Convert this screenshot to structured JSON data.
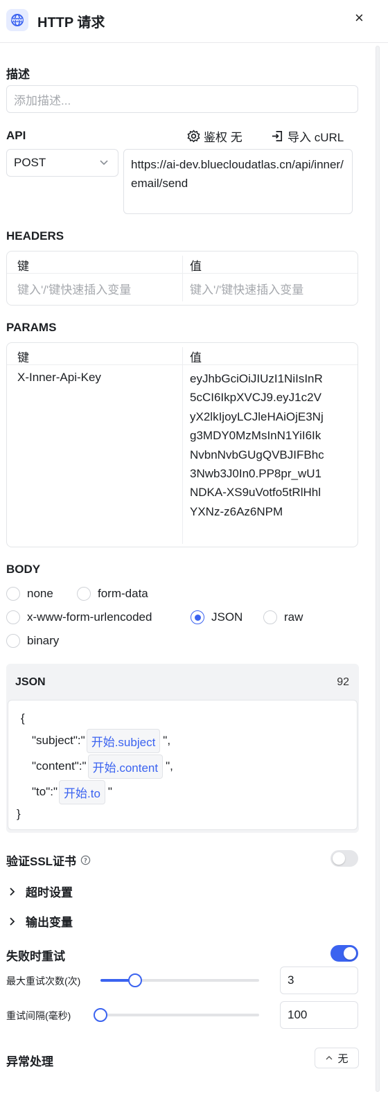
{
  "header": {
    "title": "HTTP 请求",
    "close_label": "×"
  },
  "description": {
    "label": "描述",
    "placeholder": "添加描述..."
  },
  "api": {
    "label": "API",
    "auth_label": "鉴权 无",
    "import_label": "导入 cURL",
    "method": "POST",
    "url": "https://ai-dev.bluecloudatlas.cn/api/inner/email/send"
  },
  "headers": {
    "label": "HEADERS",
    "col_key": "键",
    "col_value": "值",
    "key_placeholder": "键入'/'键快速插入变量",
    "value_placeholder": "键入'/'键快速插入变量"
  },
  "params": {
    "label": "PARAMS",
    "col_key": "键",
    "col_value": "值",
    "rows": [
      {
        "key": "X-Inner-Api-Key",
        "value": "eyJhbGciOiJIUzI1NiIsInR5cCI6IkpXVCJ9.eyJ1c2VyX2lkIjoyLCJleHAiOjE3Njg3MDY0MzMsInN1YiI6IkNvbnNvbGUgQVBJIFBhc3Nwb3J0In0.PP8pr_wU1NDKA-XS9uVotfo5tRlHhlYXNz-z6Az6NPM"
      }
    ]
  },
  "body": {
    "label": "BODY",
    "options": [
      "none",
      "form-data",
      "x-www-form-urlencoded",
      "JSON",
      "raw",
      "binary"
    ],
    "selected": "JSON",
    "json": {
      "label": "JSON",
      "char_count": "92",
      "open_brace": "{",
      "close_brace": "}",
      "lines": [
        {
          "key": "\"subject\":\"",
          "var": "开始.subject",
          "tail": "\","
        },
        {
          "key": "\"content\":\"",
          "var": "开始.content",
          "tail": "\","
        },
        {
          "key": "\"to\":\"",
          "var": "开始.to",
          "tail": "\""
        }
      ]
    }
  },
  "ssl": {
    "label": "验证SSL证书",
    "enabled": false
  },
  "timeout": {
    "label": "超时设置"
  },
  "output_vars": {
    "label": "输出变量"
  },
  "retry": {
    "label": "失败时重试",
    "enabled": true,
    "max_label": "最大重试次数(次)",
    "max_value": "3",
    "max_fraction": 0.22,
    "interval_label": "重试间隔(毫秒)",
    "interval_value": "100",
    "interval_fraction": 0.0
  },
  "error_handling": {
    "label": "异常处理",
    "button_label": "无"
  },
  "colors": {
    "accent": "#3b63f0"
  }
}
